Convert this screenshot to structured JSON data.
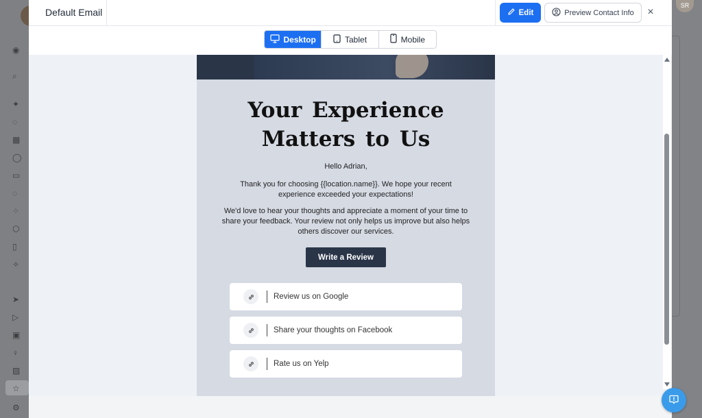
{
  "modal": {
    "title": "Default Email",
    "edit_label": "Edit",
    "preview_contact_label": "Preview Contact Info",
    "close_symbol": "×"
  },
  "devices": {
    "items": [
      {
        "label": "Desktop",
        "icon": "monitor-icon",
        "active": true
      },
      {
        "label": "Tablet",
        "icon": "tablet-icon",
        "active": false
      },
      {
        "label": "Mobile",
        "icon": "mobile-icon",
        "active": false
      }
    ]
  },
  "email": {
    "title_line1": "Your Experience",
    "title_line2": "Matters to Us",
    "greeting": "Hello Adrian,",
    "paragraph1": "Thank you for choosing {{location.name}}. We hope your recent experience exceeded your expectations!",
    "paragraph2": "We'd love to hear your thoughts and appreciate a moment of your time to share your feedback. Your review not only helps us improve but also helps others discover our services.",
    "cta_label": "Write a Review",
    "links": [
      {
        "label": "Review us on Google",
        "icon": "link-icon"
      },
      {
        "label": "Share your thoughts on Facebook",
        "icon": "link-icon"
      },
      {
        "label": "Rate us on Yelp",
        "icon": "link-icon"
      }
    ]
  },
  "background": {
    "user_initials": "SR"
  },
  "colors": {
    "primary": "#1d6ff2",
    "email_bg": "#d5dae3",
    "cta_bg": "#2a3548",
    "fab": "#3a9bea"
  }
}
